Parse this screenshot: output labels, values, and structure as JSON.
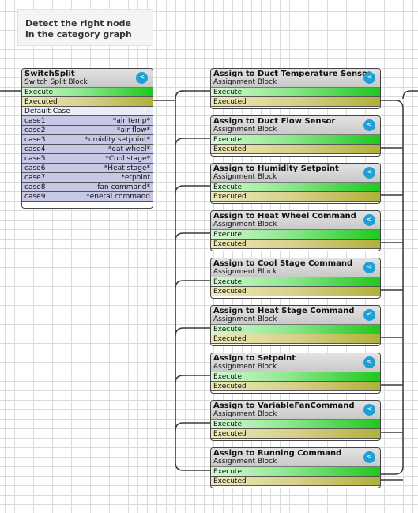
{
  "note": {
    "line1": "Detect the right node",
    "line2": "in the category graph"
  },
  "switch_node": {
    "title": "SwitchSplit",
    "subtitle": "Switch Split Block",
    "execute": "Execute",
    "executed": "Executed",
    "default_case": {
      "label": "Default Case",
      "value": "-"
    },
    "cases": [
      {
        "label": "case1",
        "value": "*air temp*"
      },
      {
        "label": "case2",
        "value": "*air flow*"
      },
      {
        "label": "case3",
        "value": "*umidity setpoint*"
      },
      {
        "label": "case4",
        "value": "*eat wheel*"
      },
      {
        "label": "case5",
        "value": "*Cool stage*"
      },
      {
        "label": "case6",
        "value": "*Heat stage*"
      },
      {
        "label": "case7",
        "value": "*etpoint"
      },
      {
        "label": "case8",
        "value": "fan command*"
      },
      {
        "label": "case9",
        "value": "*eneral command"
      }
    ]
  },
  "assign_nodes": [
    {
      "title": "Assign to Duct Temperature Sensor",
      "subtitle": "Assignment Block",
      "execute": "Execute",
      "executed": "Executed"
    },
    {
      "title": "Assign to Duct Flow Sensor",
      "subtitle": "Assignment Block",
      "execute": "Execute",
      "executed": "Executed"
    },
    {
      "title": "Assign to Humidity Setpoint",
      "subtitle": "Assignment Block",
      "execute": "Execute",
      "executed": "Executed"
    },
    {
      "title": "Assign to Heat Wheel Command",
      "subtitle": "Assignment Block",
      "execute": "Execute",
      "executed": "Executed"
    },
    {
      "title": "Assign to Cool Stage Command",
      "subtitle": "Assignment Block",
      "execute": "Execute",
      "executed": "Executed"
    },
    {
      "title": "Assign to Heat Stage Command",
      "subtitle": "Assignment Block",
      "execute": "Execute",
      "executed": "Executed"
    },
    {
      "title": "Assign to Setpoint",
      "subtitle": "Assignment Block",
      "execute": "Execute",
      "executed": "Executed"
    },
    {
      "title": "Assign to VariableFanCommand",
      "subtitle": "Assignment Block",
      "execute": "Execute",
      "executed": "Executed"
    },
    {
      "title": "Assign to Running Command",
      "subtitle": "Assignment Block",
      "execute": "Execute",
      "executed": "Executed"
    }
  ],
  "icons": {
    "share": "share-icon"
  },
  "colors": {
    "execute": "#1ec81e",
    "executed": "#b0b03a",
    "case_row": "#c7c7e6",
    "share": "#1e9fd6"
  }
}
